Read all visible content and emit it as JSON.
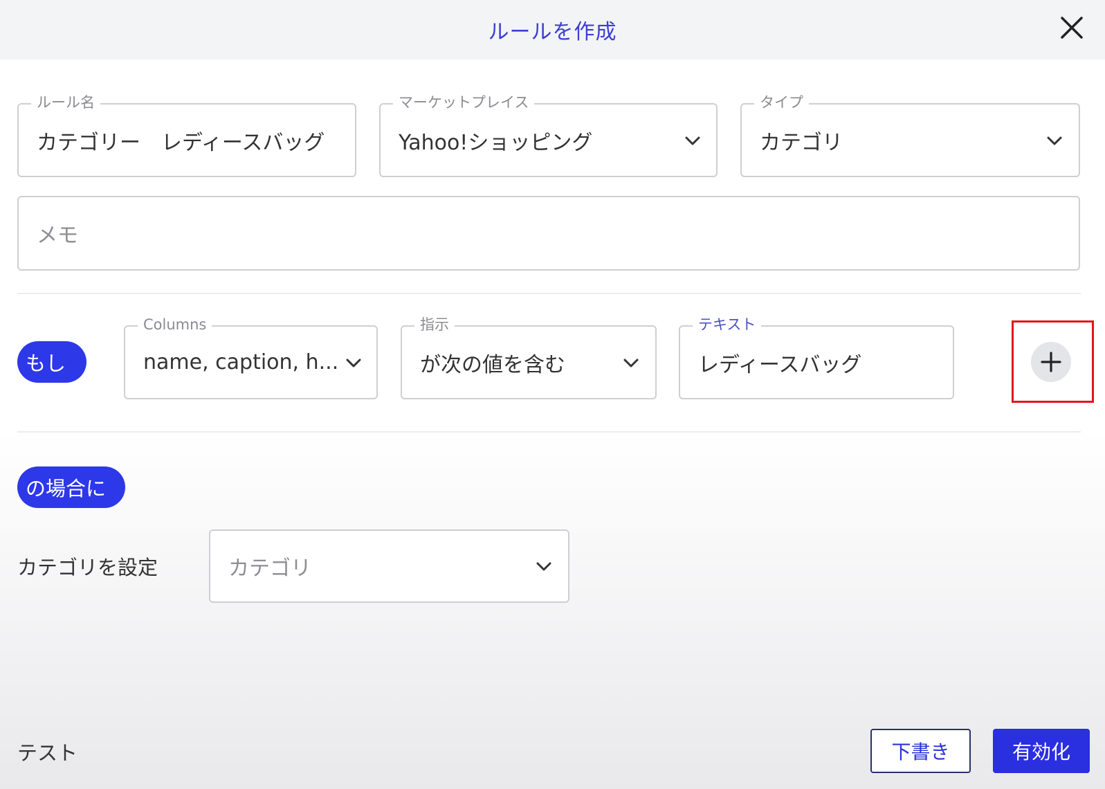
{
  "dialog": {
    "title": "ルールを作成",
    "close_icon": "close-icon"
  },
  "rule_name": {
    "label": "ルール名",
    "value": "カテゴリー　レディースバッグ"
  },
  "marketplace": {
    "label": "マーケットプレイス",
    "value": "Yahoo!ショッピング"
  },
  "type": {
    "label": "タイプ",
    "value": "カテゴリ"
  },
  "memo": {
    "placeholder": "メモ"
  },
  "condition": {
    "if_label": "もし",
    "columns": {
      "label": "Columns",
      "value": "name, caption, h..."
    },
    "operator": {
      "label": "指示",
      "value": "が次の値を含む"
    },
    "text": {
      "label": "テキスト",
      "value": "レディースバッグ"
    },
    "add_icon": "plus-icon"
  },
  "action": {
    "then_label": "の場合に",
    "set_category_label": "カテゴリを設定",
    "category_select": {
      "placeholder": "カテゴリ"
    }
  },
  "footer": {
    "test_label": "テスト",
    "draft_label": "下書き",
    "enable_label": "有効化"
  },
  "colors": {
    "accent": "#2d38e8",
    "title": "#3b3fd1",
    "highlight": "#e3141b"
  }
}
